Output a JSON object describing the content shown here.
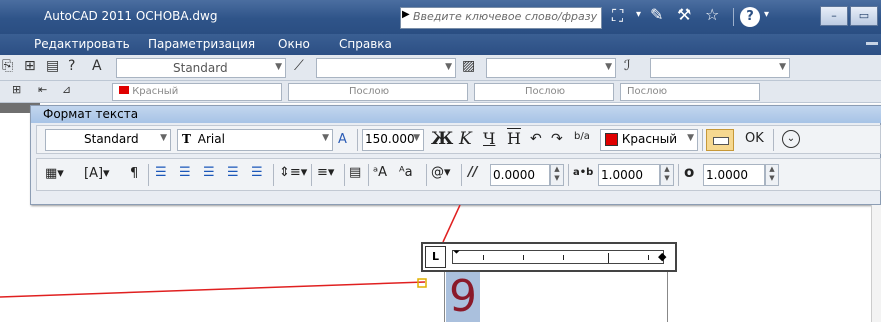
{
  "titlebar": {
    "app_title": "AutoCAD 2011   ОСНОВА.dwg",
    "search_placeholder": "Введите ключевое слово/фразу",
    "search_arrow": "▶",
    "help_label": "?",
    "minimize": "–",
    "restore": "▭",
    "dropdown_arrow": "▾"
  },
  "menu": {
    "items": [
      "Редактировать",
      "Параметризация",
      "Окно",
      "Справка"
    ]
  },
  "toolbar1": {
    "text_style": "Standard"
  },
  "toolbar2": {
    "color_value": "Красный",
    "layer1": "Послою",
    "layer2": "Послою",
    "layer3": "Послою"
  },
  "format_panel": {
    "title": "Формат текста",
    "style": "Standard",
    "font": "Arial",
    "font_icon": "T",
    "annotative_icon": "A",
    "height": "150.000",
    "bold": "Ж",
    "italic": "K",
    "underline": "Ч",
    "overline": "Н",
    "undo": "↶",
    "redo": "↷",
    "stack": "b/a",
    "color": "Красный",
    "color_swatch": "#e00000",
    "ok_label": "OK",
    "oblique_label": "0.0000",
    "oblique_symbol": "//",
    "tracking_label": "1.0000",
    "tracking_symbol": "a•b",
    "width_label": "1.0000",
    "width_symbol": "o",
    "at_symbol": "@",
    "numbering": "≡"
  },
  "canvas": {
    "text_content": "9",
    "line_color": "#e02020",
    "ruler_corner": "L",
    "text_color": "#8a1a2a"
  }
}
